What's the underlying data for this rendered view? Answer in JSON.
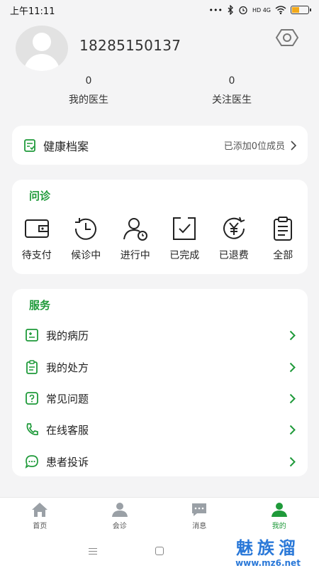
{
  "status_bar": {
    "time": "上午11:11",
    "dots": "•••",
    "network": "HD 4G"
  },
  "profile": {
    "phone": "18285150137",
    "stats": [
      {
        "value": "0",
        "label": "我的医生"
      },
      {
        "value": "0",
        "label": "关注医生"
      }
    ]
  },
  "health_record": {
    "title": "健康档案",
    "members_text": "已添加0位成员"
  },
  "consultation": {
    "title": "问诊",
    "items": [
      {
        "label": "待支付",
        "icon": "wallet-icon"
      },
      {
        "label": "候诊中",
        "icon": "clock-icon"
      },
      {
        "label": "进行中",
        "icon": "user-progress-icon"
      },
      {
        "label": "已完成",
        "icon": "check-box-icon"
      },
      {
        "label": "已退费",
        "icon": "refund-icon"
      },
      {
        "label": "全部",
        "icon": "clipboard-icon"
      }
    ]
  },
  "service": {
    "title": "服务",
    "items": [
      {
        "label": "我的病历",
        "icon": "medical-record-icon"
      },
      {
        "label": "我的处方",
        "icon": "prescription-icon"
      },
      {
        "label": "常见问题",
        "icon": "question-icon"
      },
      {
        "label": "在线客服",
        "icon": "phone-icon"
      },
      {
        "label": "患者投诉",
        "icon": "chat-icon"
      }
    ]
  },
  "tabbar": [
    {
      "label": "首页",
      "icon": "home-icon",
      "active": false
    },
    {
      "label": "会诊",
      "icon": "consult-icon",
      "active": false
    },
    {
      "label": "消息",
      "icon": "message-icon",
      "active": false
    },
    {
      "label": "我的",
      "icon": "profile-icon",
      "active": true
    }
  ],
  "watermark": {
    "brand": "魅族溜",
    "url": "www.mz6.net"
  },
  "colors": {
    "accent": "#1f9a3a",
    "background": "#f4f4f5",
    "battery": "#f2a91a"
  }
}
